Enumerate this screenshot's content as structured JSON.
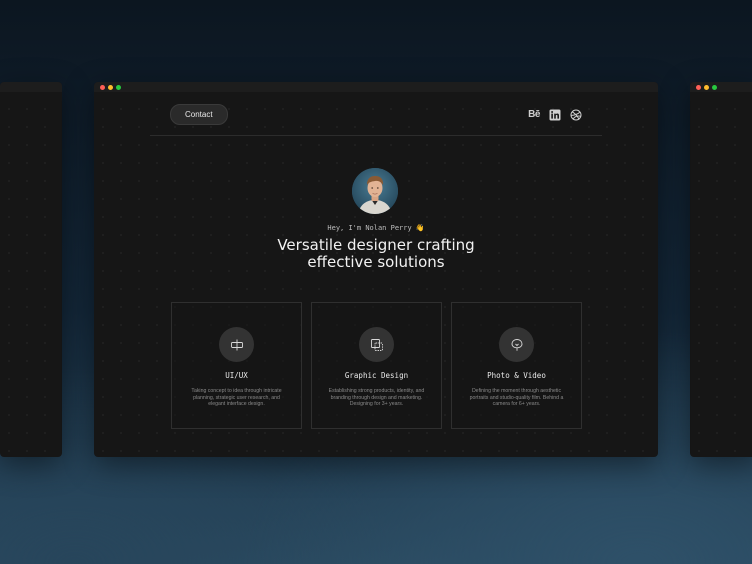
{
  "nav": {
    "contact_label": "Contact",
    "socials": [
      {
        "name": "behance",
        "label": "Bē",
        "icon": "behance-icon"
      },
      {
        "name": "linkedin",
        "icon": "linkedin-icon"
      },
      {
        "name": "dribbble",
        "icon": "dribbble-icon"
      }
    ]
  },
  "hero": {
    "greeting": "Hey, I'm Nolan Perry 👋",
    "headline_line1": "Versatile designer crafting",
    "headline_line2": "effective solutions"
  },
  "services": [
    {
      "title": "UI/UX",
      "icon": "ui-ux-icon",
      "description": "Taking concept to idea through intricate planning, strategic user research, and elegant interface design."
    },
    {
      "title": "Graphic Design",
      "icon": "graphic-design-icon",
      "description": "Establishing strong products, identity, and branding through design and marketing. Designing for 3+ years."
    },
    {
      "title": "Photo & Video",
      "icon": "photo-video-icon",
      "description": "Defining the moment through aesthetic portraits and studio-quality film. Behind a camera for 6+ years."
    }
  ],
  "colors": {
    "dot_red": "#ff5f57",
    "dot_yellow": "#febc2e",
    "dot_green": "#28c840"
  }
}
